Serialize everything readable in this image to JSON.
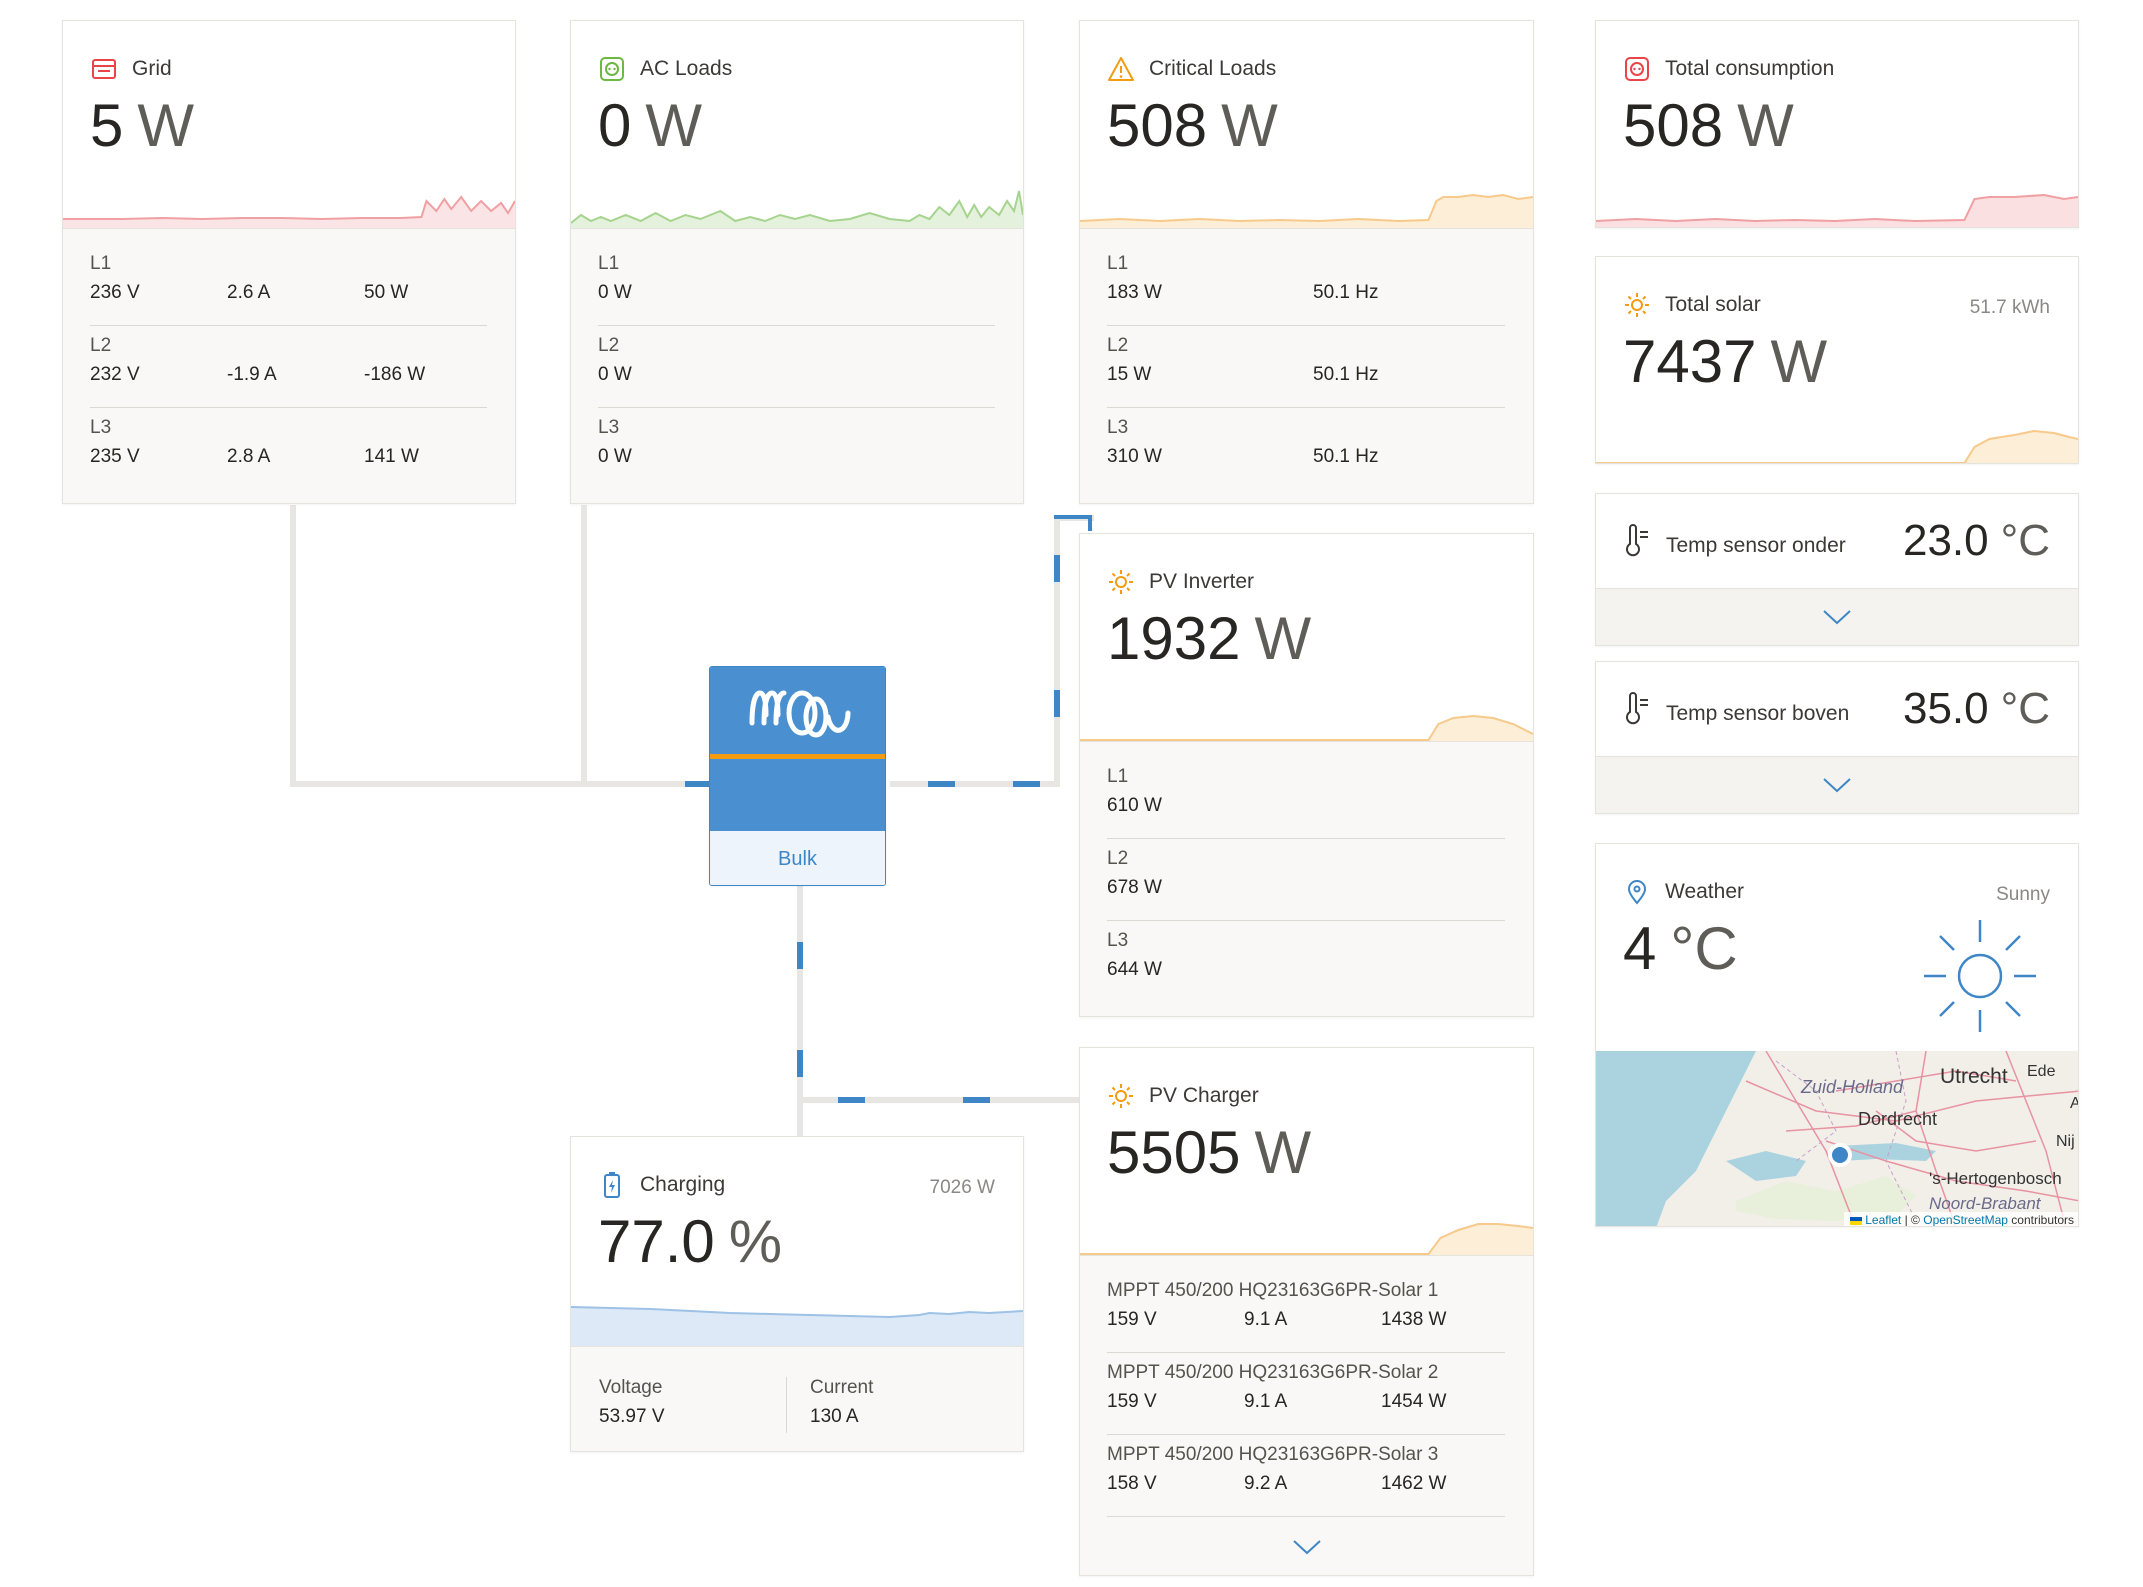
{
  "grid": {
    "title": "Grid",
    "value": "5",
    "unit": "W",
    "phases": [
      {
        "label": "L1",
        "voltage": "236 V",
        "current": "2.6 A",
        "power": "50 W"
      },
      {
        "label": "L2",
        "voltage": "232 V",
        "current": "-1.9 A",
        "power": "-186 W"
      },
      {
        "label": "L3",
        "voltage": "235 V",
        "current": "2.8 A",
        "power": "141 W"
      }
    ]
  },
  "ac_loads": {
    "title": "AC Loads",
    "value": "0",
    "unit": "W",
    "phases": [
      {
        "label": "L1",
        "power": "0 W"
      },
      {
        "label": "L2",
        "power": "0 W"
      },
      {
        "label": "L3",
        "power": "0 W"
      }
    ]
  },
  "critical_loads": {
    "title": "Critical Loads",
    "value": "508",
    "unit": "W",
    "phases": [
      {
        "label": "L1",
        "power": "183 W",
        "frequency": "50.1 Hz"
      },
      {
        "label": "L2",
        "power": "15 W",
        "frequency": "50.1 Hz"
      },
      {
        "label": "L3",
        "power": "310 W",
        "frequency": "50.1 Hz"
      }
    ]
  },
  "total_consumption": {
    "title": "Total consumption",
    "value": "508",
    "unit": "W"
  },
  "total_solar": {
    "title": "Total solar",
    "value": "7437",
    "unit": "W",
    "energy": "51.7 kWh"
  },
  "temp_onder": {
    "title": "Temp sensor onder",
    "value": "23.0",
    "unit": "°C"
  },
  "temp_boven": {
    "title": "Temp sensor boven",
    "value": "35.0",
    "unit": "°C"
  },
  "weather": {
    "title": "Weather",
    "condition": "Sunny",
    "value": "4",
    "unit": "°C",
    "map_labels": [
      "Zuid-Holland",
      "Utrecht",
      "Ede",
      "Dordrecht",
      "Nij",
      "'s-Hertogenbosch",
      "Noord-Brabant",
      "A"
    ],
    "attribution": {
      "leaflet": "Leaflet",
      "separator": "| ©",
      "osm": "OpenStreetMap",
      "suffix": "contributors"
    }
  },
  "pv_inverter": {
    "title": "PV Inverter",
    "value": "1932",
    "unit": "W",
    "phases": [
      {
        "label": "L1",
        "power": "610 W"
      },
      {
        "label": "L2",
        "power": "678 W"
      },
      {
        "label": "L3",
        "power": "644 W"
      }
    ]
  },
  "pv_charger": {
    "title": "PV Charger",
    "value": "5505",
    "unit": "W",
    "chargers": [
      {
        "name": "MPPT 450/200 HQ23163G6PR-Solar 1",
        "voltage": "159 V",
        "current": "9.1 A",
        "power": "1438 W"
      },
      {
        "name": "MPPT 450/200 HQ23163G6PR-Solar 2",
        "voltage": "159 V",
        "current": "9.1 A",
        "power": "1454 W"
      },
      {
        "name": "MPPT 450/200 HQ23163G6PR-Solar 3",
        "voltage": "158 V",
        "current": "9.2 A",
        "power": "1462 W"
      }
    ]
  },
  "inverter": {
    "state": "Bulk"
  },
  "battery": {
    "title": "Charging",
    "value": "77.0",
    "unit": "%",
    "power": "7026 W",
    "voltage_label": "Voltage",
    "voltage": "53.97 V",
    "current_label": "Current",
    "current": "130 A"
  },
  "colors": {
    "grid": "#e9444a",
    "ac_loads": "#6cb842",
    "critical": "#f39c12",
    "solar": "#f39c12",
    "battery": "#3f86c7",
    "accent": "#3f86c7"
  }
}
